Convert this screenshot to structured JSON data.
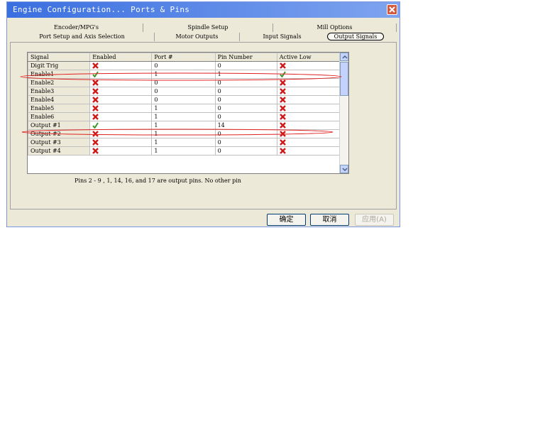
{
  "window": {
    "title": "Engine Configuration... Ports & Pins"
  },
  "tabs": {
    "row1": [
      "Encoder/MPG's",
      "Spindle Setup",
      "Mill Options"
    ],
    "row2": [
      "Port Setup and Axis Selection",
      "Motor Outputs",
      "Input Signals",
      "Output Signals"
    ],
    "active": "Output Signals"
  },
  "grid": {
    "columns": [
      "Signal",
      "Enabled",
      "Port #",
      "Pin Number",
      "Active Low"
    ],
    "rows": [
      {
        "signal": "Digit  Trig",
        "enabled": false,
        "port": "0",
        "pin": "0",
        "active_low": false
      },
      {
        "signal": "Enable1",
        "enabled": true,
        "port": "1",
        "pin": "1",
        "active_low": true
      },
      {
        "signal": "Enable2",
        "enabled": false,
        "port": "0",
        "pin": "0",
        "active_low": false
      },
      {
        "signal": "Enable3",
        "enabled": false,
        "port": "0",
        "pin": "0",
        "active_low": false
      },
      {
        "signal": "Enable4",
        "enabled": false,
        "port": "0",
        "pin": "0",
        "active_low": false
      },
      {
        "signal": "Enable5",
        "enabled": false,
        "port": "1",
        "pin": "0",
        "active_low": false
      },
      {
        "signal": "Enable6",
        "enabled": false,
        "port": "1",
        "pin": "0",
        "active_low": false
      },
      {
        "signal": "Output #1",
        "enabled": true,
        "port": "1",
        "pin": "14",
        "active_low": false
      },
      {
        "signal": "Output #2",
        "enabled": false,
        "port": "1",
        "pin": "0",
        "active_low": false
      },
      {
        "signal": "Output #3",
        "enabled": false,
        "port": "1",
        "pin": "0",
        "active_low": false
      },
      {
        "signal": "Output #4",
        "enabled": false,
        "port": "1",
        "pin": "0",
        "active_low": false
      }
    ]
  },
  "note": "Pins 2 - 9 , 1, 14, 16, and 17 are output pins.  No  other pin",
  "buttons": {
    "ok": "确定",
    "cancel": "取消",
    "apply": "应用(A)"
  },
  "colors": {
    "title_start": "#3a6fe0",
    "title_end": "#7fa4ef",
    "annotation_red": "#e02020",
    "check_green": "#3a9a28",
    "x_red": "#d01818"
  }
}
